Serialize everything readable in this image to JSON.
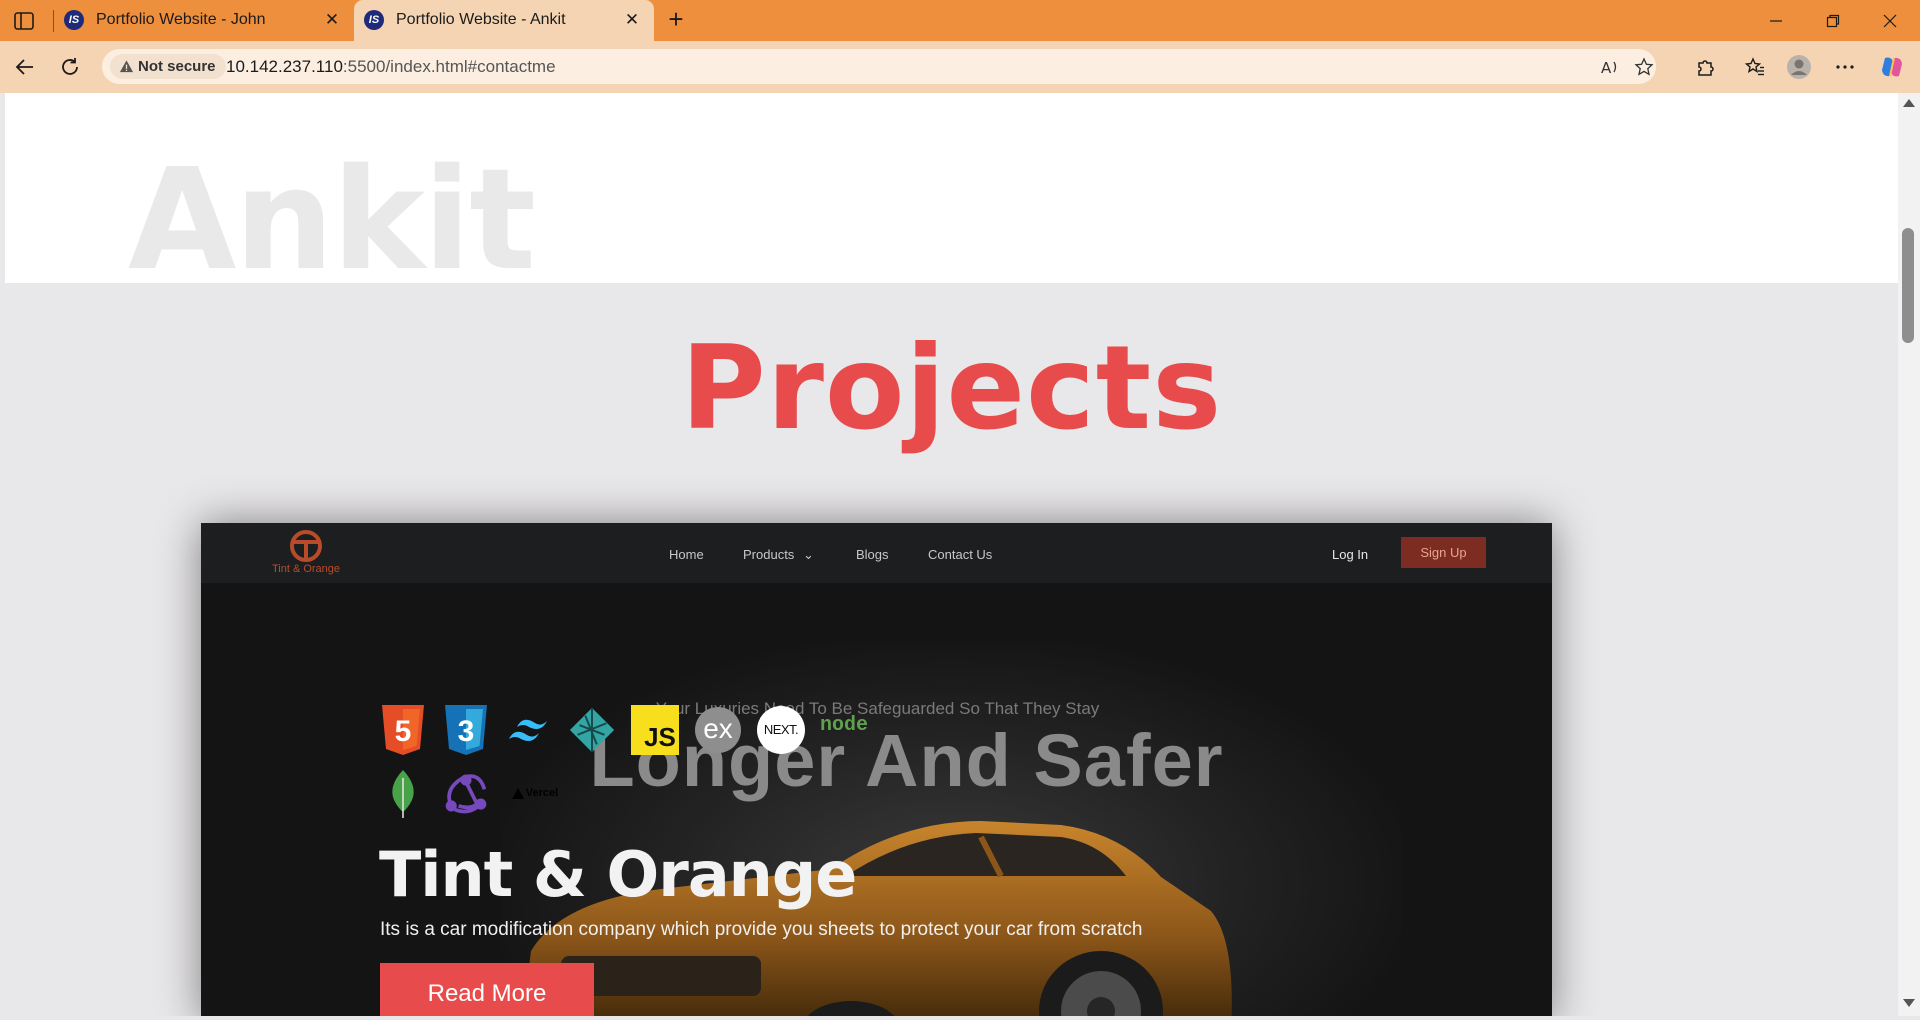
{
  "browser": {
    "tabs": [
      {
        "title": "Portfolio Website - John",
        "favicon": "IS",
        "active": false
      },
      {
        "title": "Portfolio Website - Ankit",
        "favicon": "IS",
        "active": true
      }
    ],
    "security_label": "Not secure",
    "url_host": "10.142.237.110",
    "url_rest": ":5500/index.html#contactme",
    "accent_color": "#ed8f3c"
  },
  "page": {
    "background_name": "Ankit",
    "projects_heading": "Projects",
    "project": {
      "nav": {
        "logo_text": "Tint & Orange",
        "menu": [
          "Home",
          "Products",
          "Blogs",
          "Contact Us"
        ],
        "login": "Log In",
        "signup": "Sign Up"
      },
      "hero_tagline": "Your Luxuries Need To Be Safeguarded So That They Stay",
      "hero_big": "Longer And Safer",
      "tech_icons": [
        "html5-icon",
        "css3-icon",
        "tailwind-icon",
        "netlify-icon",
        "javascript-icon",
        "express-icon",
        "nextjs-icon",
        "nodejs-icon",
        "mongodb-icon",
        "redux-icon",
        "vercel-icon"
      ],
      "tech_labels": {
        "js": "JS",
        "ex": "ex",
        "next": "NEXT.",
        "node": "node",
        "vercel": "Vercel"
      },
      "title": "Tint & Orange",
      "description": "Its is a car modification company which provide you sheets to protect your car from scratch",
      "cta": "Read More"
    }
  }
}
